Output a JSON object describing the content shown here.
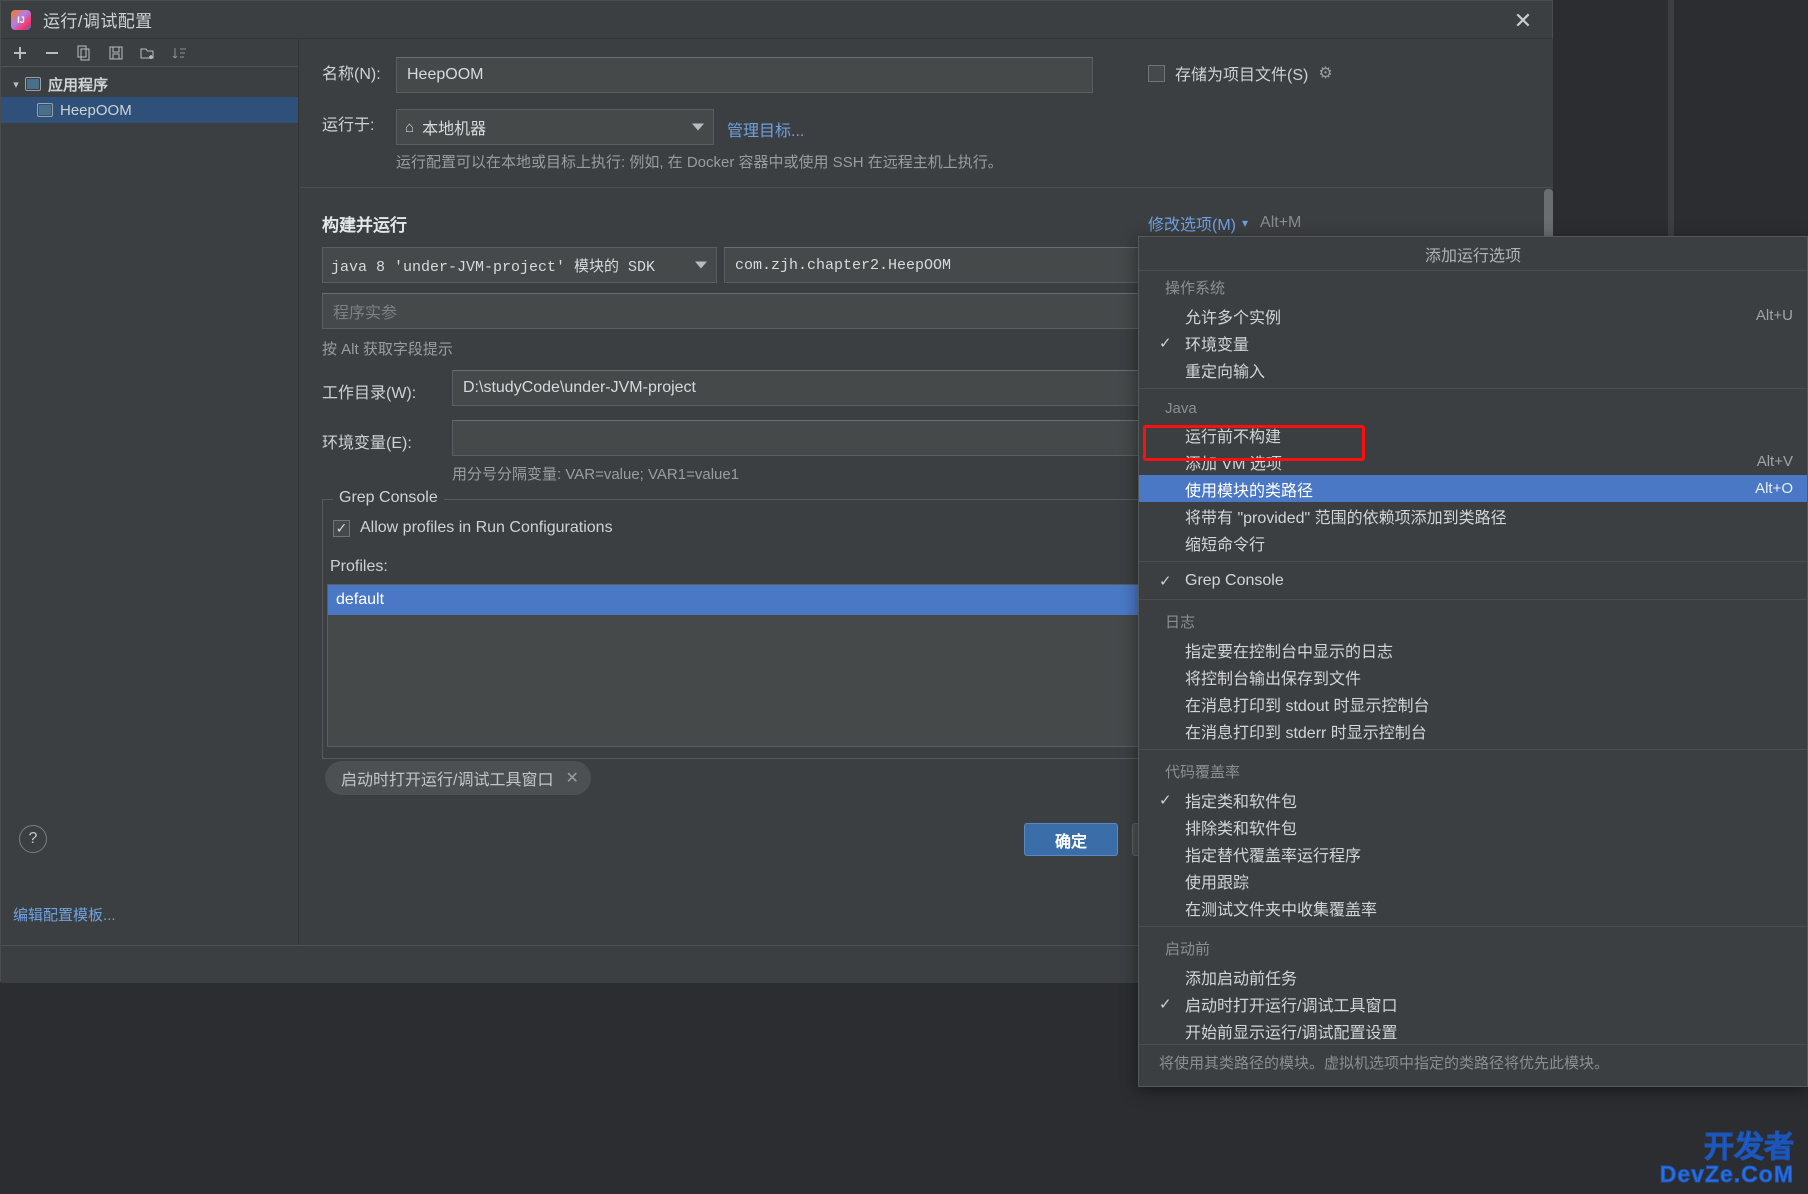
{
  "window": {
    "title": "运行/调试配置",
    "logo_icon": "intellij-idea-icon",
    "close_icon": "close-icon"
  },
  "left_panel": {
    "toolbar": [
      {
        "name": "add-button",
        "icon": "plus-icon"
      },
      {
        "name": "remove-button",
        "icon": "minus-icon"
      },
      {
        "name": "copy-button",
        "icon": "copy-icon"
      },
      {
        "name": "save-button",
        "icon": "save-icon"
      },
      {
        "name": "move-to-folder-button",
        "icon": "new-folder-icon"
      },
      {
        "name": "sort-button",
        "icon": "sort-icon"
      }
    ],
    "tree": [
      {
        "label": "应用程序",
        "level": 0,
        "expanded": true,
        "selected": false
      },
      {
        "label": "HeepOOM",
        "level": 1,
        "expanded": false,
        "selected": true
      }
    ],
    "edit_templates_link": "编辑配置模板..."
  },
  "form": {
    "name_label": "名称(N):",
    "name_value": "HeepOOM",
    "store_as_project_file_label": "存储为项目文件(S)",
    "store_as_project_file_checked": false,
    "gear_icon": "gear-icon",
    "run_on_label": "运行于:",
    "run_on_value": "本地机器",
    "run_on_icon": "home-icon",
    "manage_targets_link": "管理目标...",
    "run_on_hint": "运行配置可以在本地或目标上执行: 例如, 在 Docker 容器中或使用 SSH 在远程主机上执行。",
    "build_and_run_title": "构建并运行",
    "modify_options_label": "修改选项(M)",
    "modify_options_shortcut": "Alt+M",
    "sdk_value": "java 8  'under-JVM-project' 模块的 SDK",
    "main_class_value": "com.zjh.chapter2.HeepOOM",
    "program_args_placeholder": "程序实参",
    "program_args_hint": "按 Alt 获取字段提示",
    "working_dir_label": "工作目录(W):",
    "working_dir_value": "D:\\studyCode\\under-JVM-project",
    "env_vars_label": "环境变量(E):",
    "env_vars_value": "",
    "env_vars_hint": "用分号分隔变量: VAR=value; VAR1=value1",
    "grep_console_legend": "Grep Console",
    "allow_profiles_label": "Allow profiles in Run Configurations",
    "allow_profiles_checked": true,
    "profiles_label": "Profiles:",
    "profiles": [
      {
        "label": "default",
        "selected": true
      }
    ],
    "before_launch_chip": "启动时打开运行/调试工具窗口",
    "chip_remove_icon": "close-icon",
    "help_icon": "question-mark-icon",
    "ok_button": "确定",
    "cancel_button": ""
  },
  "menu": {
    "header": "添加运行选项",
    "sections": [
      {
        "group": "操作系统",
        "items": [
          {
            "label": "允许多个实例",
            "checked": false,
            "shortcut": "Alt+U",
            "selected": false
          },
          {
            "label": "环境变量",
            "checked": true,
            "shortcut": "",
            "selected": false
          },
          {
            "label": "重定向输入",
            "checked": false,
            "shortcut": "",
            "selected": false
          }
        ]
      },
      {
        "group": "Java",
        "items": [
          {
            "label": "运行前不构建",
            "checked": false,
            "shortcut": "",
            "selected": false
          },
          {
            "label": "添加 VM 选项",
            "checked": false,
            "shortcut": "Alt+V",
            "selected": false,
            "highlighted": true
          },
          {
            "label": "使用模块的类路径",
            "checked": false,
            "shortcut": "Alt+O",
            "selected": true
          },
          {
            "label": "将带有 \"provided\" 范围的依赖项添加到类路径",
            "checked": false,
            "shortcut": "",
            "selected": false
          },
          {
            "label": "缩短命令行",
            "checked": false,
            "shortcut": "",
            "selected": false
          }
        ]
      },
      {
        "group": "",
        "items": [
          {
            "label": "Grep Console",
            "checked": true,
            "shortcut": "",
            "selected": false
          }
        ]
      },
      {
        "group": "日志",
        "items": [
          {
            "label": "指定要在控制台中显示的日志",
            "checked": false,
            "shortcut": "",
            "selected": false
          },
          {
            "label": "将控制台输出保存到文件",
            "checked": false,
            "shortcut": "",
            "selected": false
          },
          {
            "label": "在消息打印到 stdout 时显示控制台",
            "checked": false,
            "shortcut": "",
            "selected": false
          },
          {
            "label": "在消息打印到 stderr 时显示控制台",
            "checked": false,
            "shortcut": "",
            "selected": false
          }
        ]
      },
      {
        "group": "代码覆盖率",
        "items": [
          {
            "label": "指定类和软件包",
            "checked": true,
            "shortcut": "",
            "selected": false
          },
          {
            "label": "排除类和软件包",
            "checked": false,
            "shortcut": "",
            "selected": false
          },
          {
            "label": "指定替代覆盖率运行程序",
            "checked": false,
            "shortcut": "",
            "selected": false
          },
          {
            "label": "使用跟踪",
            "checked": false,
            "shortcut": "",
            "selected": false
          },
          {
            "label": "在测试文件夹中收集覆盖率",
            "checked": false,
            "shortcut": "",
            "selected": false
          }
        ]
      },
      {
        "group": "启动前",
        "items": [
          {
            "label": "添加启动前任务",
            "checked": false,
            "shortcut": "",
            "selected": false
          },
          {
            "label": "启动时打开运行/调试工具窗口",
            "checked": true,
            "shortcut": "",
            "selected": false
          },
          {
            "label": "开始前显示运行/调试配置设置",
            "checked": false,
            "shortcut": "",
            "selected": false
          }
        ]
      }
    ],
    "footer": "将使用其类路径的模块。虚拟机选项中指定的类路径将优先此模块。"
  },
  "watermark": {
    "line1": "开发者",
    "line2": "DevZe.CoM"
  },
  "colors": {
    "accent_blue": "#4a78c4",
    "link_blue": "#6fa0e0",
    "highlight_red": "#fb0f0f",
    "dialog_bg": "#3c3f41",
    "field_bg": "#45494a"
  }
}
